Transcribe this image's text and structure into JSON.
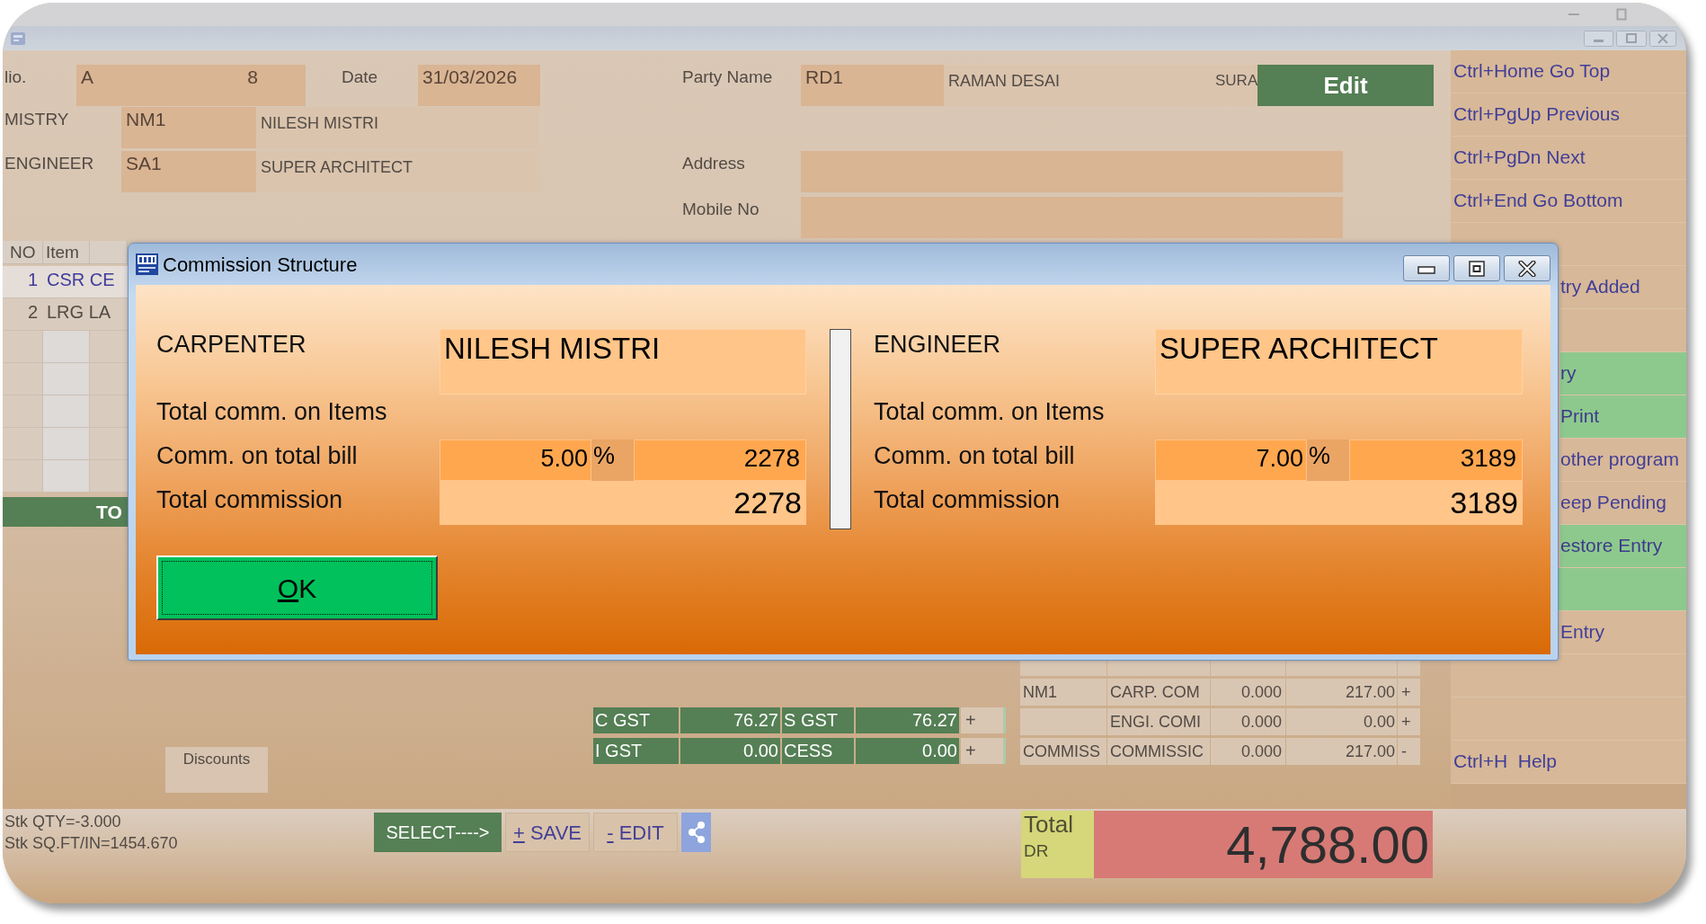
{
  "main_window": {
    "form": {
      "bill_label": "lio.",
      "bill_series": "A",
      "bill_number": "8",
      "date_label": "Date",
      "date": "31/03/2026",
      "party_label": "Party Name",
      "party_code": "RD1",
      "party_name": "RAMAN DESAI",
      "party_field_3": "SURA",
      "edit_button": "Edit",
      "mistry_label": "MISTRY",
      "mistry_code": "NM1",
      "mistry_name": "NILESH MISTRI",
      "engineer_label": "ENGINEER",
      "engineer_code": "SA1",
      "engineer_name": "SUPER ARCHITECT",
      "address_label": "Address",
      "mobile_label": "Mobile No"
    },
    "item_table": {
      "columns": [
        "NO",
        "Item"
      ],
      "rows": [
        {
          "number": "1",
          "item": "CSR CE",
          "selected": true
        },
        {
          "number": "2",
          "item": "LRG LA",
          "selected": false
        }
      ],
      "total_label": "TO"
    },
    "discounts_button": "Discounts",
    "tax_grid": [
      {
        "label_1": "C GST",
        "value_1": "76.27",
        "label_2": "S GST",
        "value_2": "76.27",
        "sign": "+"
      },
      {
        "label_1": "I GST",
        "value_1": "0.00",
        "label_2": "CESS",
        "value_2": "0.00",
        "sign": "+"
      }
    ],
    "charges_table": [
      {
        "code": "NM1",
        "name": "CARP. COM",
        "qty": "0.000",
        "amount": "217.00",
        "sign": "+"
      },
      {
        "name": "ENGI. COMI",
        "qty": "0.000",
        "amount": "0.00",
        "sign": "+"
      },
      {
        "code": "COMMISS",
        "name": "COMMISSIC",
        "qty": "0.000",
        "amount": "217.00",
        "sign": "-"
      }
    ],
    "shortcuts": [
      {
        "label": "Ctrl+Home Go Top",
        "kind": "full",
        "highlighted": false
      },
      {
        "label": "Ctrl+PgUp Previous",
        "kind": "full",
        "highlighted": false
      },
      {
        "label": "Ctrl+PgDn Next",
        "kind": "full",
        "highlighted": false
      },
      {
        "label": "Ctrl+End Go Bottom",
        "kind": "full",
        "highlighted": false
      },
      {
        "highlighted": false
      },
      {
        "label": "try Added",
        "kind": "cut",
        "highlighted": false
      },
      {
        "highlighted": false
      },
      {
        "label": "ry",
        "kind": "cut",
        "highlighted": true
      },
      {
        "label": "Print",
        "kind": "cut",
        "highlighted": true
      },
      {
        "label": "other program",
        "kind": "cut",
        "highlighted": false
      },
      {
        "label": "eep Pending",
        "kind": "cut",
        "highlighted": false
      },
      {
        "label": "estore Entry",
        "kind": "cut",
        "highlighted": true
      },
      {
        "highlighted": true
      },
      {
        "label": "Entry",
        "kind": "cut",
        "highlighted": false
      },
      {
        "highlighted": false
      },
      {
        "highlighted": false
      },
      {
        "label": "Ctrl+H  Help",
        "kind": "full",
        "highlighted": false
      }
    ],
    "status_bar": {
      "stock_lines": [
        "Stk QTY=-3.000",
        "Stk SQ.FT/IN=1454.670"
      ],
      "buttons": [
        {
          "kind": "select",
          "label": "SELECT---->"
        },
        {
          "kind": "plain",
          "label": "+ SAVE"
        },
        {
          "kind": "plain",
          "label": "- EDIT"
        },
        {
          "kind": "share"
        }
      ],
      "total_label": "Total",
      "balance_side": "DR",
      "total_amount": "4,788.00"
    }
  },
  "dialog": {
    "title": "Commission Structure",
    "sections": [
      {
        "role": "CARPENTER",
        "name": "NILESH MISTRI",
        "items_label": "Total comm. on Items",
        "bill_label": "Comm. on total bill",
        "percent": "5.00",
        "percent_sign": "%",
        "bill_amount": "2278",
        "total_label": "Total commission",
        "total": "2278"
      },
      {
        "role": "ENGINEER",
        "name": "SUPER ARCHITECT",
        "items_label": "Total comm. on Items",
        "bill_label": "Comm. on total bill",
        "percent": "7.00",
        "percent_sign": "%",
        "bill_amount": "3189",
        "total_label": "Total commission",
        "total": "3189"
      }
    ],
    "ok_button": {
      "label": "OK",
      "focused": true
    }
  }
}
